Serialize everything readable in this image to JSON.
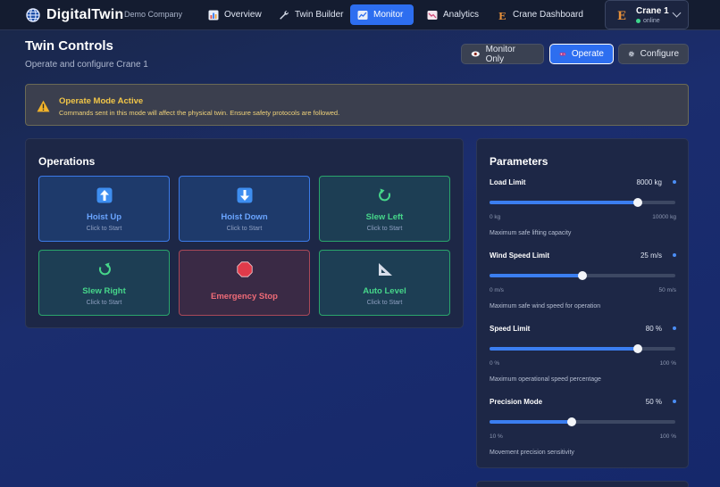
{
  "nav": {
    "brand": "DigitalTwin",
    "company": "Demo Company",
    "items": [
      {
        "label": "Overview",
        "icon": "chart-icon"
      },
      {
        "label": "Twin Builder",
        "icon": "wrench-icon"
      },
      {
        "label": "Monitor",
        "icon": "monitor-icon",
        "active": true
      },
      {
        "label": "Analytics",
        "icon": "analytics-icon"
      },
      {
        "label": "Crane Dashboard",
        "icon": "crane-icon"
      }
    ],
    "crane": {
      "badge": "E",
      "name": "Crane 1",
      "status": "online"
    }
  },
  "header": {
    "title": "Twin Controls",
    "subtitle": "Operate and configure Crane 1",
    "modes": [
      {
        "label": "Monitor Only",
        "icon": "eye-icon"
      },
      {
        "label": "Operate",
        "icon": "gamepad-icon",
        "active": true
      },
      {
        "label": "Configure",
        "icon": "gear-icon"
      }
    ]
  },
  "warning": {
    "title": "Operate Mode Active",
    "text": "Commands sent in this mode will affect the physical twin. Ensure safety protocols are followed."
  },
  "operations": {
    "title": "Operations",
    "buttons": [
      {
        "label": "Hoist Up",
        "hint": "Click to Start",
        "icon": "arrow-up-icon",
        "color": "blue"
      },
      {
        "label": "Hoist Down",
        "hint": "Click to Start",
        "icon": "arrow-down-icon",
        "color": "blue"
      },
      {
        "label": "Slew Left",
        "hint": "Click to Start",
        "icon": "rotate-left-icon",
        "color": "green"
      },
      {
        "label": "Slew Right",
        "hint": "Click to Start",
        "icon": "rotate-right-icon",
        "color": "green"
      },
      {
        "label": "Emergency Stop",
        "hint": "",
        "icon": "stop-icon",
        "color": "red"
      },
      {
        "label": "Auto Level",
        "hint": "Click to Start",
        "icon": "set-square-icon",
        "color": "green"
      }
    ]
  },
  "parameters": {
    "title": "Parameters",
    "items": [
      {
        "name": "Load Limit",
        "value": "8000 kg",
        "min": "0 kg",
        "max": "10000 kg",
        "description": "Maximum safe lifting capacity",
        "fraction": 0.8
      },
      {
        "name": "Wind Speed Limit",
        "value": "25 m/s",
        "min": "0 m/s",
        "max": "50 m/s",
        "description": "Maximum safe wind speed for operation",
        "fraction": 0.5
      },
      {
        "name": "Speed Limit",
        "value": "80 %",
        "min": "0 %",
        "max": "100 %",
        "description": "Maximum operational speed percentage",
        "fraction": 0.8
      },
      {
        "name": "Precision Mode",
        "value": "50 %",
        "min": "10 %",
        "max": "100 %",
        "description": "Movement precision sensitivity",
        "fraction": 0.444
      }
    ]
  },
  "colors": {
    "accent": "#2d6ef0",
    "success": "#46d68a",
    "danger": "#ee6b77",
    "warning": "#f2c648"
  }
}
